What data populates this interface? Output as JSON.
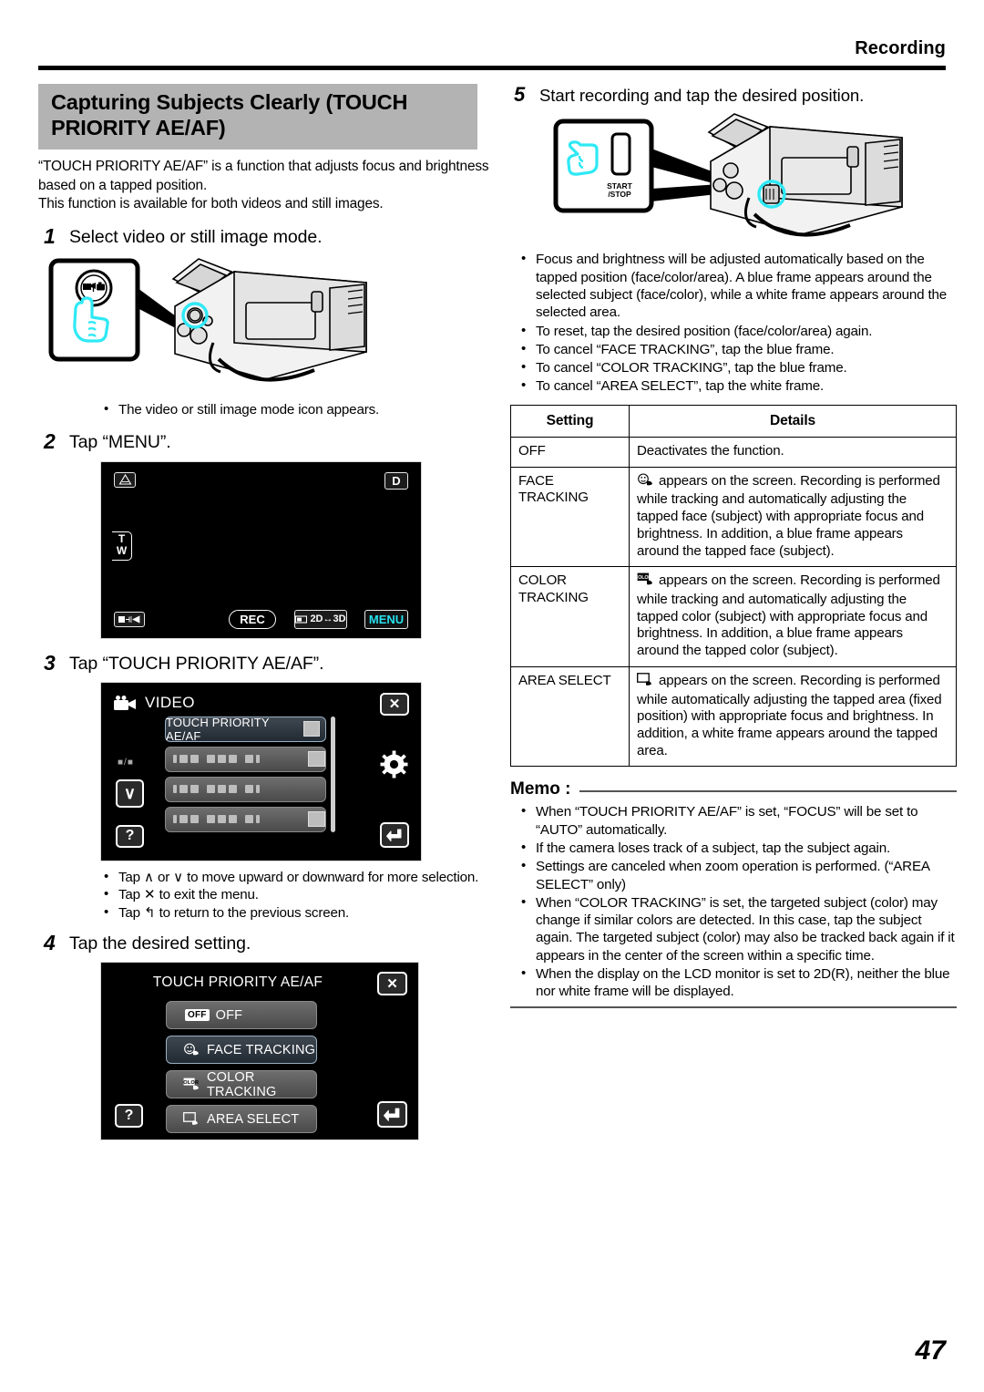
{
  "header": {
    "title": "Recording"
  },
  "section": {
    "title": "Capturing Subjects Clearly (TOUCH PRIORITY AE/AF)",
    "intro_line1": "“TOUCH PRIORITY AE/AF” is a function that adjusts focus and brightness based on a tapped position.",
    "intro_line2": "This function is available for both videos and still images."
  },
  "steps": {
    "s1": {
      "num": "1",
      "text": "Select video or still image mode."
    },
    "s2": {
      "num": "2",
      "text": "Tap “MENU”."
    },
    "s3": {
      "num": "3",
      "text": "Tap “TOUCH PRIORITY AE/AF”."
    },
    "s4": {
      "num": "4",
      "text": "Tap the desired setting."
    },
    "s5": {
      "num": "5",
      "text": "Start recording and tap the desired position."
    }
  },
  "step1": {
    "callout_icon": "video-still-mode-button-icon",
    "hand_icon": "pointing-hand-icon",
    "camera_icon": "camcorder-illustration",
    "note": "The video or still image mode icon appears."
  },
  "step2_lcd": {
    "tripod_icon": "tripod-warning-icon",
    "display_badge": "D",
    "zoom_tele": "T",
    "zoom_wide": "W",
    "playback_icon": "record-playback-switch-icon",
    "rec_label": "REC",
    "dimension_label": "2D↔3D",
    "menu_label": "MENU"
  },
  "step3_lcd": {
    "mode_icon": "video-camera-icon",
    "title": "VIDEO",
    "close_label": "✕",
    "page_indicator": "■/■",
    "down_arrow": "∨",
    "help_label": "?",
    "gear_icon": "gear-icon",
    "back_icon": "back-arrow-icon",
    "rows": [
      {
        "label": "TOUCH PRIORITY AE/AF",
        "selected": true,
        "has_thumb": true
      },
      {
        "label": "",
        "selected": false,
        "has_thumb": true
      },
      {
        "label": "",
        "selected": false,
        "has_thumb": false
      },
      {
        "label": "",
        "selected": false,
        "has_thumb": true
      }
    ]
  },
  "step3_notes": [
    "Tap ∧ or ∨ to move upward or downward for more selection.",
    "Tap ✕ to exit the menu.",
    "Tap ↰ to return to the previous screen."
  ],
  "step4_lcd": {
    "title": "TOUCH PRIORITY AE/AF",
    "close_label": "✕",
    "help_label": "?",
    "back_icon": "back-arrow-icon",
    "options": [
      {
        "badge": "OFF",
        "label": "OFF",
        "selected": false
      },
      {
        "badge": "face-tracking-icon",
        "label": "FACE TRACKING",
        "selected": true
      },
      {
        "badge": "COLOR",
        "label": "COLOR TRACKING",
        "selected": false
      },
      {
        "badge": "area-select-icon",
        "label": "AREA SELECT",
        "selected": false
      }
    ]
  },
  "step5": {
    "button_label_line1": "START",
    "button_label_line2": "/STOP",
    "hand_icon": "pointing-hand-icon",
    "camera_icon": "camcorder-illustration",
    "notes": [
      "Focus and brightness will be adjusted automatically based on the tapped position (face/color/area). A blue frame appears around the selected subject (face/color), while a white frame appears around the selected area.",
      "To reset, tap the desired position (face/color/area) again.",
      "To cancel “FACE TRACKING”, tap the blue frame.",
      "To cancel “COLOR TRACKING”, tap the blue frame.",
      "To cancel “AREA SELECT”, tap the white frame."
    ]
  },
  "table": {
    "headers": {
      "setting": "Setting",
      "details": "Details"
    },
    "rows": [
      {
        "setting": "OFF",
        "icon": "",
        "details": "Deactivates the function."
      },
      {
        "setting": "FACE TRACKING",
        "icon": "face-tracking-icon",
        "details": "appears on the screen. Recording is performed while tracking and automatically adjusting the tapped face (subject) with appropriate focus and brightness. In addition, a blue frame appears around the tapped face (subject)."
      },
      {
        "setting": "COLOR TRACKING",
        "icon": "color-tracking-icon",
        "details": "appears on the screen. Recording is performed while tracking and automatically adjusting the tapped color (subject) with appropriate focus and brightness. In addition, a blue frame appears around the tapped color (subject)."
      },
      {
        "setting": "AREA SELECT",
        "icon": "area-select-icon",
        "details": "appears on the screen. Recording is performed while automatically adjusting the tapped area (fixed position) with appropriate focus and brightness. In addition, a white frame appears around the tapped area."
      }
    ]
  },
  "memo": {
    "label": "Memo :",
    "items": [
      "When “TOUCH PRIORITY AE/AF” is set, “FOCUS” will be set to “AUTO” automatically.",
      "If the camera loses track of a subject, tap the subject again.",
      "Settings are canceled when zoom operation is performed. (“AREA SELECT” only)",
      "When “COLOR TRACKING” is set, the targeted subject (color) may change if similar colors are detected. In this case, tap the subject again. The targeted subject (color) may also be tracked back again if it appears in the center of the screen within a specific time.",
      "When the display on the LCD monitor is set to 2D(R), neither the blue nor white frame will be displayed."
    ]
  },
  "page": {
    "number": "47"
  },
  "colors": {
    "banner_gray": "#b3b3b3",
    "cyan_accent": "#27e0ee",
    "lcd_black": "#000000",
    "rule_black": "#000000"
  }
}
